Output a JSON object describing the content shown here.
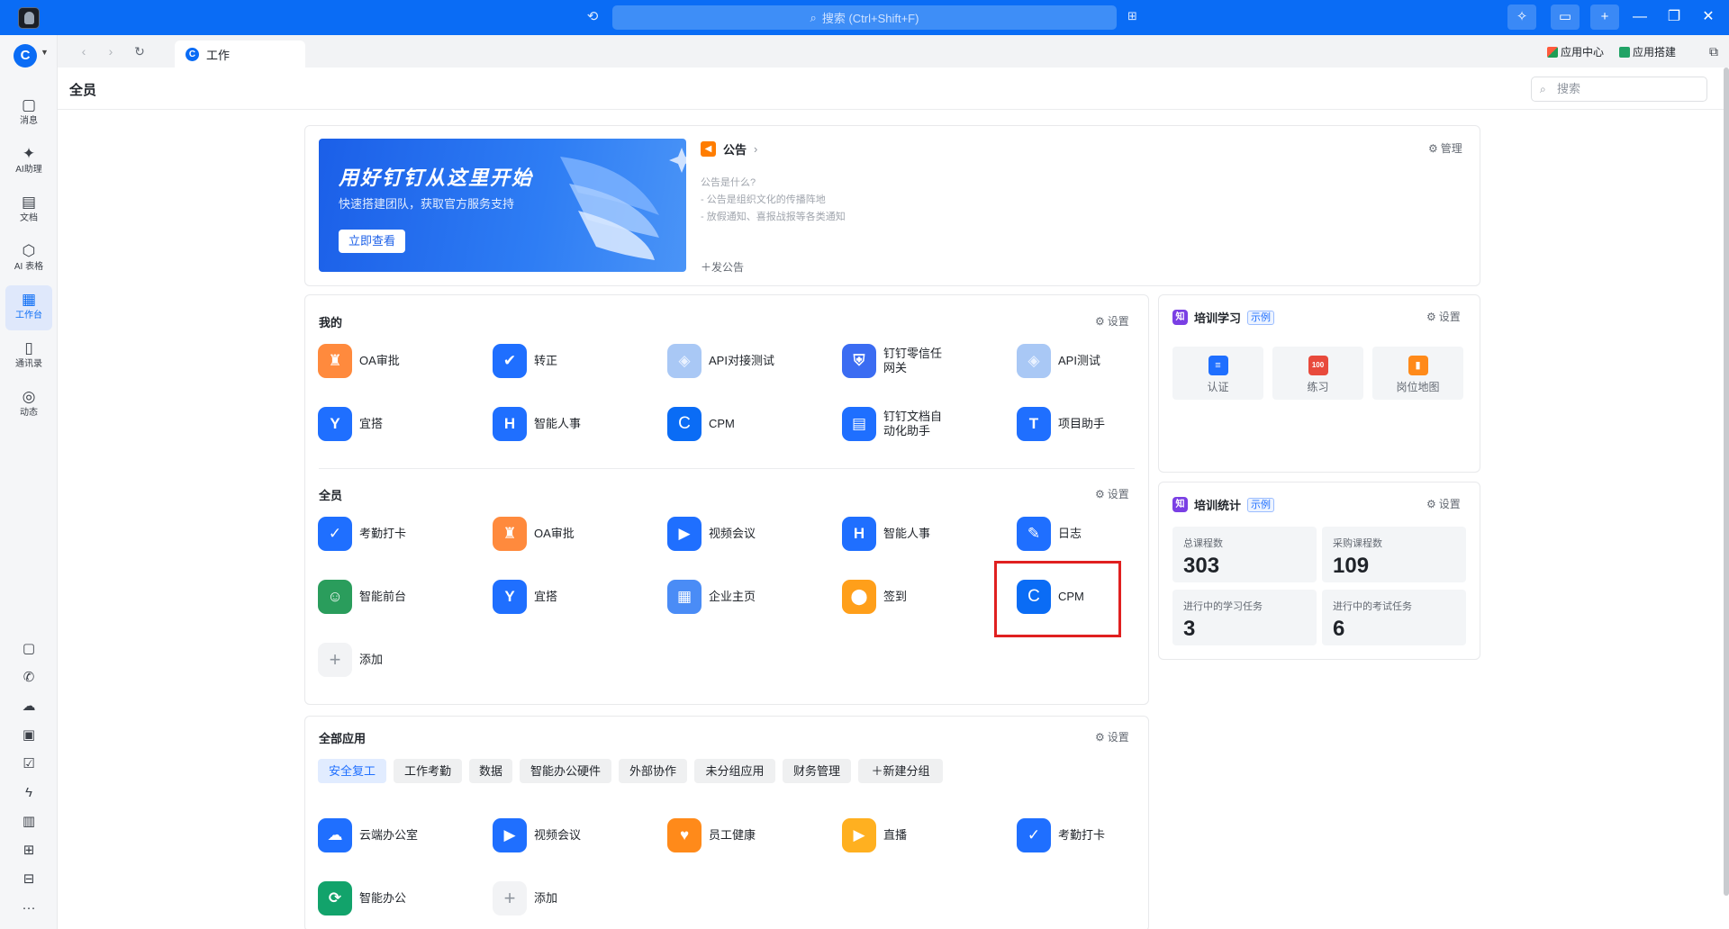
{
  "titlebar": {
    "search_placeholder": "搜索 (Ctrl+Shift+F)"
  },
  "rail": {
    "org_letter": "C",
    "items": [
      {
        "label": "消息",
        "icon": "message-icon"
      },
      {
        "label": "AI助理",
        "icon": "ai-assistant-icon"
      },
      {
        "label": "文档",
        "icon": "document-icon"
      },
      {
        "label": "AI 表格",
        "icon": "ai-table-icon"
      },
      {
        "label": "工作台",
        "icon": "workbench-icon"
      },
      {
        "label": "通讯录",
        "icon": "contacts-icon"
      },
      {
        "label": "动态",
        "icon": "moments-icon"
      }
    ],
    "more": "···"
  },
  "tabstrip": {
    "tab_label": "工作",
    "tab_icon_letter": "C",
    "app_center": "应用中心",
    "app_builder": "应用搭建"
  },
  "page": {
    "title": "全员",
    "search_placeholder": "搜索"
  },
  "banner": {
    "title": "用好钉钉从这里开始",
    "subtitle": "快速搭建团队，获取官方服务支持",
    "button": "立即查看"
  },
  "notice": {
    "title": "公告",
    "manage": "管理",
    "lines": [
      "公告是什么?",
      "- 公告是组织文化的传播阵地",
      "- 放假通知、喜报战报等各类通知"
    ],
    "post": "发公告"
  },
  "mine": {
    "title": "我的",
    "settings": "设置",
    "apps": [
      {
        "label": "OA审批",
        "icon": "approval-stamp-icon",
        "color": "#ff8a3d"
      },
      {
        "label": "转正",
        "icon": "user-check-icon",
        "color": "#1f6fff"
      },
      {
        "label": "API对接测试",
        "icon": "api-icon",
        "color": "#a9c8f5"
      },
      {
        "label": "钉钉零信任\n网关",
        "icon": "shield-icon",
        "color": "#3b6cf2"
      },
      {
        "label": "API测试",
        "icon": "api-icon",
        "color": "#a9c8f5"
      },
      {
        "label": "宜搭",
        "icon": "yida-icon",
        "color": "#1f6fff"
      },
      {
        "label": "智能人事",
        "icon": "hr-icon",
        "color": "#1f6fff"
      },
      {
        "label": "CPM",
        "icon": "cpm-icon",
        "color": "#0a6cf5",
        "letter": "C"
      },
      {
        "label": "钉钉文档自\n动化助手",
        "icon": "doc-automation-icon",
        "color": "#1f6fff"
      },
      {
        "label": "项目助手",
        "icon": "project-icon",
        "color": "#1f6fff"
      }
    ]
  },
  "all_staff": {
    "title": "全员",
    "settings": "设置",
    "apps": [
      {
        "label": "考勤打卡",
        "icon": "attendance-icon",
        "color": "#1f6fff"
      },
      {
        "label": "OA审批",
        "icon": "approval-stamp-icon",
        "color": "#ff8a3d"
      },
      {
        "label": "视频会议",
        "icon": "video-icon",
        "color": "#1f6fff"
      },
      {
        "label": "智能人事",
        "icon": "hr-icon",
        "color": "#1f6fff"
      },
      {
        "label": "日志",
        "icon": "log-icon",
        "color": "#1f6fff"
      },
      {
        "label": "智能前台",
        "icon": "front-desk-icon",
        "color": "#2a9d5c"
      },
      {
        "label": "宜搭",
        "icon": "yida-icon",
        "color": "#1f6fff"
      },
      {
        "label": "企业主页",
        "icon": "company-page-icon",
        "color": "#4a8cf6"
      },
      {
        "label": "签到",
        "icon": "checkin-icon",
        "color": "#ff9f1a"
      },
      {
        "label": "CPM",
        "icon": "cpm-icon",
        "color": "#0a6cf5",
        "letter": "C"
      }
    ],
    "add": "添加"
  },
  "all_apps": {
    "title": "全部应用",
    "settings": "设置",
    "groups": [
      "安全复工",
      "工作考勤",
      "数据",
      "智能办公硬件",
      "外部协作",
      "未分组应用",
      "财务管理",
      "新建分组"
    ],
    "apps": [
      {
        "label": "云端办公室",
        "icon": "cloud-office-icon",
        "color": "#1f6fff"
      },
      {
        "label": "视频会议",
        "icon": "video-icon",
        "color": "#1f6fff"
      },
      {
        "label": "员工健康",
        "icon": "health-icon",
        "color": "#ff8a1a"
      },
      {
        "label": "直播",
        "icon": "live-icon",
        "color": "#ffb020"
      },
      {
        "label": "考勤打卡",
        "icon": "attendance-icon",
        "color": "#1f6fff"
      },
      {
        "label": "智能办公",
        "icon": "smart-office-icon",
        "color": "#12a36b"
      }
    ],
    "add": "添加"
  },
  "training": {
    "title": "培训学习",
    "tag": "示例",
    "settings": "设置",
    "tiles": [
      {
        "label": "认证",
        "icon": "certificate-icon",
        "color": "#1f6fff"
      },
      {
        "label": "练习",
        "icon": "practice-icon",
        "color": "#e84a3c",
        "badge": "100"
      },
      {
        "label": "岗位地图",
        "icon": "job-map-icon",
        "color": "#ff8a1a"
      }
    ]
  },
  "training_stats": {
    "title": "培训统计",
    "tag": "示例",
    "settings": "设置",
    "stats": [
      {
        "label": "总课程数",
        "value": "303"
      },
      {
        "label": "采购课程数",
        "value": "109"
      },
      {
        "label": "进行中的学习任务",
        "value": "3"
      },
      {
        "label": "进行中的考试任务",
        "value": "6"
      }
    ]
  }
}
